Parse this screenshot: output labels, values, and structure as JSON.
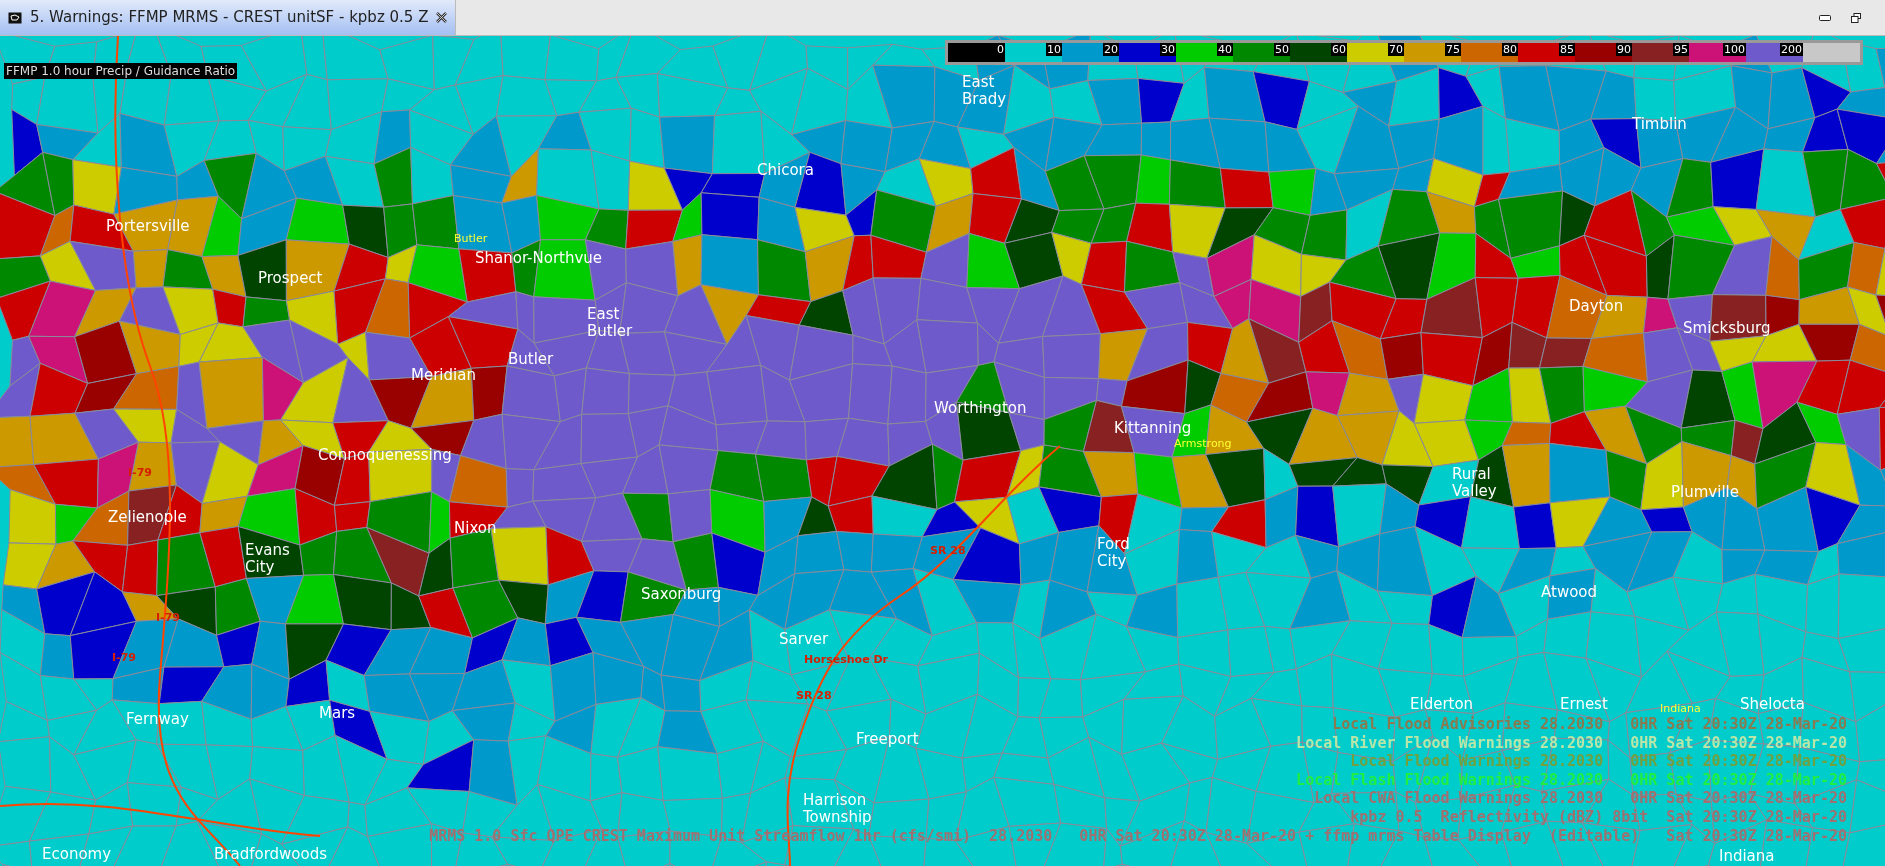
{
  "window": {
    "tab_title": "5. Warnings: FFMP MRMS - CREST unitSF - kpbz 0.5 Z"
  },
  "map": {
    "product_label": "FFMP 1.0 hour Precip / Guidance Ratio",
    "colorbar": [
      {
        "label": "0",
        "color": "#000000"
      },
      {
        "label": "10",
        "color": "#00cccc"
      },
      {
        "label": "20",
        "color": "#0099cc"
      },
      {
        "label": "30",
        "color": "#0000cc"
      },
      {
        "label": "40",
        "color": "#00cc00"
      },
      {
        "label": "50",
        "color": "#008800"
      },
      {
        "label": "60",
        "color": "#004400"
      },
      {
        "label": "70",
        "color": "#cccc00"
      },
      {
        "label": "75",
        "color": "#cc9900"
      },
      {
        "label": "80",
        "color": "#cc6600"
      },
      {
        "label": "85",
        "color": "#cc0000"
      },
      {
        "label": "90",
        "color": "#990000"
      },
      {
        "label": "95",
        "color": "#882222"
      },
      {
        "label": "100",
        "color": "#cc1177"
      },
      {
        "label": "200",
        "color": "#6f5acc"
      },
      {
        "color": "#c8c8c8"
      }
    ],
    "places": [
      {
        "name": "East\nBrady",
        "kind": "town"
      },
      {
        "name": "Timblin",
        "kind": "town"
      },
      {
        "name": "Chicora",
        "kind": "town"
      },
      {
        "name": "Portersville",
        "kind": "town"
      },
      {
        "name": "Butler",
        "kind": "county"
      },
      {
        "name": "Shanor-Northvue",
        "kind": "town"
      },
      {
        "name": "Prospect",
        "kind": "town"
      },
      {
        "name": "East\nButler",
        "kind": "town"
      },
      {
        "name": "Dayton",
        "kind": "town"
      },
      {
        "name": "Smicksburg",
        "kind": "town"
      },
      {
        "name": "Butler",
        "kind": "town"
      },
      {
        "name": "Meridian",
        "kind": "town"
      },
      {
        "name": "Worthington",
        "kind": "town"
      },
      {
        "name": "Kittanning",
        "kind": "town"
      },
      {
        "name": "Armstrong",
        "kind": "county"
      },
      {
        "name": "Connoquenessing",
        "kind": "town"
      },
      {
        "name": "Rural\nValley",
        "kind": "town"
      },
      {
        "name": "Plumville",
        "kind": "town"
      },
      {
        "name": "Zelienople",
        "kind": "town"
      },
      {
        "name": "Nixon",
        "kind": "town"
      },
      {
        "name": "Evans\nCity",
        "kind": "town"
      },
      {
        "name": "Ford\nCity",
        "kind": "town"
      },
      {
        "name": "Atwood",
        "kind": "town"
      },
      {
        "name": "Saxonburg",
        "kind": "town"
      },
      {
        "name": "Sarver",
        "kind": "town"
      },
      {
        "name": "Elderton",
        "kind": "town"
      },
      {
        "name": "Mars",
        "kind": "town"
      },
      {
        "name": "Fernway",
        "kind": "town"
      },
      {
        "name": "Freeport",
        "kind": "town"
      },
      {
        "name": "Ernest",
        "kind": "town"
      },
      {
        "name": "Indiana",
        "kind": "county"
      },
      {
        "name": "Shelocta",
        "kind": "town"
      },
      {
        "name": "Economy",
        "kind": "town"
      },
      {
        "name": "Bradfordwoods",
        "kind": "town"
      },
      {
        "name": "Harrison\nTownship",
        "kind": "town"
      },
      {
        "name": "Indiana",
        "kind": "town"
      }
    ],
    "roads": [
      {
        "label": "I-79"
      },
      {
        "label": "I-79"
      },
      {
        "label": "I-79"
      },
      {
        "label": "SR 28"
      },
      {
        "label": "Horseshoe Dr"
      },
      {
        "label": "SR 28"
      }
    ],
    "legend": [
      {
        "text": "Local Flood Advisories 28.2030   0HR Sat 20:30Z 28-Mar-20",
        "color": "#8a7a50"
      },
      {
        "text": "Local River Flood Warnings 28.2030   0HR Sat 20:30Z 28-Mar-20",
        "color": "#b8e6a8"
      },
      {
        "text": "Local Flood Warnings 28.2030   0HR Sat 20:30Z 28-Mar-20",
        "color": "#70a040"
      },
      {
        "text": "Local Flash Flood Warnings 28.2030   0HR Sat 20:30Z 28-Mar-20",
        "color": "#20ee40"
      },
      {
        "text": "Local CWA Flood Warnings 28.2030   0HR Sat 20:30Z 28-Mar-20",
        "color": "#a07070"
      },
      {
        "text": "kpbz 0.5  Reflectivity (dBZ) 8bit  Sat 20:30Z 28-Mar-20",
        "color": "#a07070"
      }
    ],
    "bottom_line": {
      "text": "MRMS 1.0 Sfc QPE CREST Maximum Unit Streamflow 1hr (cfs/smi)  28.2030   0HR Sat 20:30Z 28-Mar-20 + ffmp mrms Table Display  (Editable)   Sat 20:30Z 28-Mar-20",
      "color": "#a07070"
    }
  }
}
